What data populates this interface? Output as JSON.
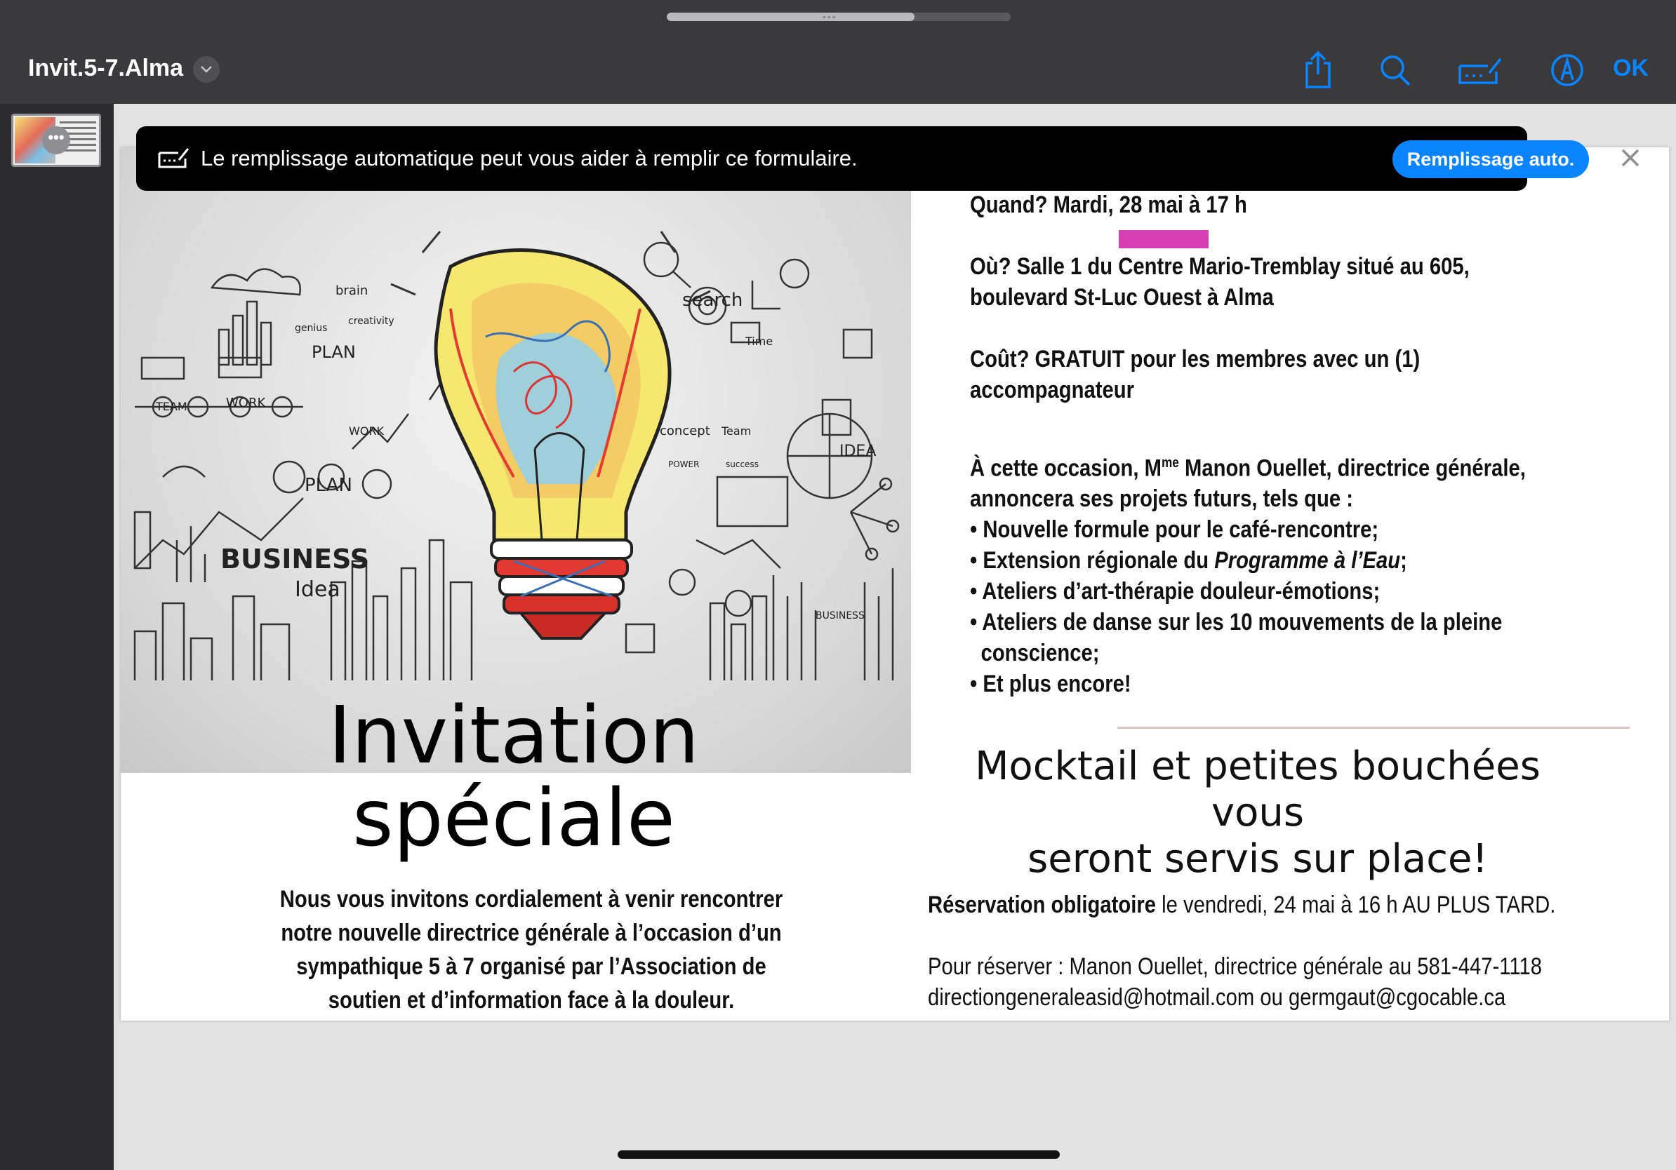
{
  "app": {
    "document_title": "Invit.5-7.Alma",
    "ok_label": "OK",
    "icons": {
      "title_menu": "chevron-down-icon",
      "share": "share-icon",
      "search": "search-icon",
      "form": "form-fill-icon",
      "markup": "markup-pen-icon",
      "thumb_more": "more-icon"
    },
    "accent_color": "#0a84ff"
  },
  "autofill": {
    "message": "Le remplissage automatique peut vous aider à remplir ce formulaire.",
    "button_label": "Remplissage auto."
  },
  "document": {
    "hero": {
      "words": {
        "brain": "brain",
        "creativity": "creativity",
        "genius": "genius",
        "plan": "PLAN",
        "team": "TEAM",
        "work": "WORK",
        "work2": "WORK",
        "search": "search",
        "time": "Time",
        "concept": "concept",
        "team2": "Team",
        "power": "POWER",
        "success": "success",
        "plan2": "PLAN",
        "idea": "IDEA",
        "business": "BUSINESS",
        "idea2": "Idea",
        "business2": "BUSINESS"
      }
    },
    "invitation_title_line1": "Invitation",
    "invitation_title_line2": "spéciale",
    "invitation_body": "Nous vous invitons cordialement à venir rencontrer notre nouvelle directrice générale à l’occasion d’un sympathique 5 à 7 organisé par l’Association de soutien et d’information face à la douleur.",
    "when": "Quand? Mardi, 28 mai à 17 h",
    "where_line1": "Où? Salle 1 du Centre Mario-Tremblay situé au 605,",
    "where_line2": "boulevard St-Luc Ouest à Alma",
    "cost_line1": "Coût? GRATUIT pour les membres avec un (1)",
    "cost_line2": "accompagnateur",
    "occasion_prefix": "À cette occasion, M",
    "occasion_sup": "me",
    "occasion_rest": " Manon Ouellet, directrice générale,",
    "occasion_line2": "annoncera ses projets futurs, tels que :",
    "bullet1": "• Nouvelle formule pour le café-rencontre;",
    "bullet2_prefix": "• Extension régionale du ",
    "bullet2_italic": "Programme à l’Eau",
    "bullet2_suffix": ";",
    "bullet3": "• Ateliers d’art-thérapie douleur-émotions;",
    "bullet4_line1": "• Ateliers de danse sur les 10 mouvements de la pleine",
    "bullet4_line2": "conscience;",
    "bullet5": "• Et plus encore!",
    "mocktail_line1": "Mocktail et petites bouchées vous",
    "mocktail_line2": "seront servis sur place!",
    "reservation_bold": "Réservation obligatoire",
    "reservation_rest": " le vendredi, 24 mai à 16 h AU PLUS TARD.",
    "contact_line1": "Pour réserver : Manon Ouellet, directrice générale au 581-447-1118",
    "contact_line2": "directiongeneraleasid@hotmail.com ou germgaut@cgocable.ca"
  }
}
